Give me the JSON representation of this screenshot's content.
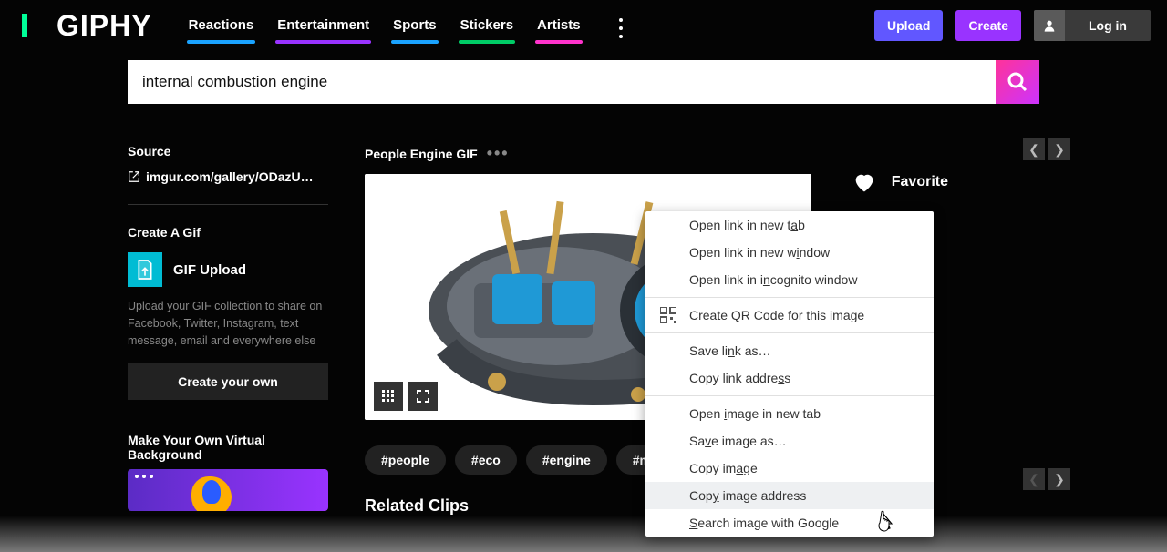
{
  "header": {
    "logo": "GIPHY",
    "nav": [
      "Reactions",
      "Entertainment",
      "Sports",
      "Stickers",
      "Artists"
    ],
    "upload": "Upload",
    "create": "Create",
    "login": "Log in"
  },
  "search": {
    "value": "internal combustion engine"
  },
  "sidebar": {
    "source_label": "Source",
    "source_link": "imgur.com/gallery/ODazU…",
    "create_gif_label": "Create A Gif",
    "gif_upload": "GIF Upload",
    "gif_upload_desc": "Upload your GIF collection to share on Facebook, Twitter, Instagram, text message, email and everywhere else",
    "create_own": "Create your own",
    "vbg_label": "Make Your Own Virtual Background"
  },
  "gif": {
    "title": "People Engine GIF",
    "favorite": "Favorite",
    "tags": [
      "#people",
      "#eco",
      "#engine",
      "#mo"
    ]
  },
  "related": {
    "heading": "Related Clips"
  },
  "context_menu": {
    "items": [
      {
        "label": "Open link in new tab",
        "u": [
          18,
          19
        ]
      },
      {
        "label": "Open link in new window",
        "u": [
          18,
          19
        ]
      },
      {
        "label": "Open link in incognito window",
        "u": [
          14,
          15
        ]
      },
      {
        "sep": true
      },
      {
        "label": "Create QR Code for this image",
        "icon": "qr"
      },
      {
        "sep": true
      },
      {
        "label": "Save link as…",
        "u": [
          7,
          8
        ]
      },
      {
        "label": "Copy link address",
        "u": [
          15,
          16
        ]
      },
      {
        "sep": true
      },
      {
        "label": "Open image in new tab",
        "u": [
          5,
          6
        ]
      },
      {
        "label": "Save image as…",
        "u": [
          2,
          3
        ]
      },
      {
        "label": "Copy image",
        "u": [
          7,
          8
        ]
      },
      {
        "label": "Copy image address",
        "u": [
          3,
          4
        ],
        "hover": true
      },
      {
        "label": "Search image with Google",
        "u": [
          0,
          1
        ]
      }
    ]
  }
}
